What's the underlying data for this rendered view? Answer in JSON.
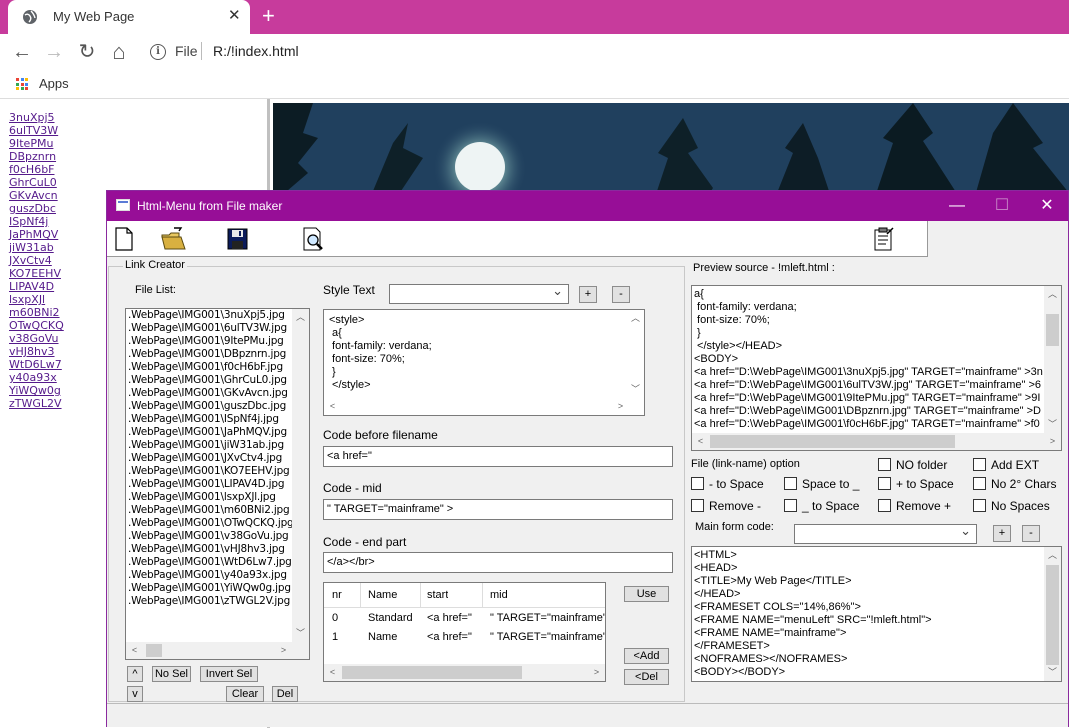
{
  "browser": {
    "tab_title": "My Web Page",
    "tab_close": "✕",
    "new_tab": "+",
    "back": "←",
    "forward": "→",
    "reload": "↻",
    "home": "⌂",
    "info": "i",
    "url_scheme": "File",
    "url": "R:/!index.html",
    "bookmark_apps": "Apps"
  },
  "menu_links": [
    "3nuXpj5",
    "6ulTV3W",
    "9ItePMu",
    "DBpznrn",
    "f0cH6bF",
    "GhrCuL0",
    "GKvAvcn",
    "guszDbc",
    "ISpNf4j",
    "JaPhMQV",
    "jiW31ab",
    "JXvCtv4",
    "KO7EEHV",
    "LIPAV4D",
    "lsxpXJl",
    "m60BNi2",
    "OTwQCKQ",
    "v38GoVu",
    "vHJ8hv3",
    "WtD6Lw7",
    "y40a93x",
    "YiWQw0g",
    "zTWGL2V"
  ],
  "app": {
    "title": "Html-Menu from File maker",
    "minimize": "—",
    "maximize": "☐",
    "close": "✕",
    "toolbar_icons": [
      "new-file-icon",
      "open-folder-icon",
      "save-icon",
      "preview-icon",
      "clipboard-icon"
    ],
    "link_creator": "Link Creator",
    "file_list_label": "File List:",
    "files": [
      ".WebPage\\IMG001\\3nuXpj5.jpg",
      ".WebPage\\IMG001\\6ulTV3W.jpg",
      ".WebPage\\IMG001\\9ItePMu.jpg",
      ".WebPage\\IMG001\\DBpznrn.jpg",
      ".WebPage\\IMG001\\f0cH6bF.jpg",
      ".WebPage\\IMG001\\GhrCuL0.jpg",
      ".WebPage\\IMG001\\GKvAvcn.jpg",
      ".WebPage\\IMG001\\guszDbc.jpg",
      ".WebPage\\IMG001\\ISpNf4j.jpg",
      ".WebPage\\IMG001\\JaPhMQV.jpg",
      ".WebPage\\IMG001\\jiW31ab.jpg",
      ".WebPage\\IMG001\\JXvCtv4.jpg",
      ".WebPage\\IMG001\\KO7EEHV.jpg",
      ".WebPage\\IMG001\\LIPAV4D.jpg",
      ".WebPage\\IMG001\\lsxpXJl.jpg",
      ".WebPage\\IMG001\\m60BNi2.jpg",
      ".WebPage\\IMG001\\OTwQCKQ.jpg",
      ".WebPage\\IMG001\\v38GoVu.jpg",
      ".WebPage\\IMG001\\vHJ8hv3.jpg",
      ".WebPage\\IMG001\\WtD6Lw7.jpg",
      ".WebPage\\IMG001\\y40a93x.jpg",
      ".WebPage\\IMG001\\YiWQw0g.jpg",
      ".WebPage\\IMG001\\zTWGL2V.jpg"
    ],
    "btn_up": "^",
    "btn_down": "v",
    "btn_nosel": "No Sel",
    "btn_invert": "Invert Sel",
    "btn_clear": "Clear",
    "btn_del": "Del",
    "style_text_label": "Style Text",
    "btn_plus": "+",
    "btn_minus": "-",
    "style_text": [
      "<style>",
      " a{",
      " font-family: verdana;",
      " font-size: 70%;",
      " }",
      " </style>"
    ],
    "code_before_label": "Code before filename",
    "code_before": "<a href=\"",
    "code_mid_label": "Code - mid",
    "code_mid": "\" TARGET=\"mainframe\" >",
    "code_end_label": "Code - end part",
    "code_end": "</a></br>",
    "grid_headers": [
      "nr",
      "Name",
      "start",
      "mid"
    ],
    "grid_rows": [
      [
        "0",
        "Standard",
        "<a href=\"",
        "\" TARGET=\"mainframe\""
      ],
      [
        "1",
        "Name",
        "<a href=\"",
        "\" TARGET=\"mainframe\""
      ]
    ],
    "btn_use": "Use",
    "btn_add": "<Add",
    "btn_delrow": "<Del",
    "preview_label": "Preview source - !mleft.html :",
    "preview_lines": [
      "a{",
      " font-family: verdana;",
      " font-size: 70%;",
      " }",
      " </style></HEAD>",
      "<BODY>",
      "<a href=\"D:\\WebPage\\IMG001\\3nuXpj5.jpg\" TARGET=\"mainframe\" >3n",
      "<a href=\"D:\\WebPage\\IMG001\\6ulTV3W.jpg\" TARGET=\"mainframe\" >6",
      "<a href=\"D:\\WebPage\\IMG001\\9ItePMu.jpg\" TARGET=\"mainframe\" >9I",
      "<a href=\"D:\\WebPage\\IMG001\\DBpznrn.jpg\" TARGET=\"mainframe\" >D",
      "<a href=\"D:\\WebPage\\IMG001\\f0cH6bF.jpg\" TARGET=\"mainframe\" >f0"
    ],
    "file_option_label": "File (link-name) option",
    "chk_no_folder": "NO folder",
    "chk_add_ext": "Add EXT",
    "chk_dash_space": "- to Space",
    "chk_space_under": "Space to _",
    "chk_plus_space": "+ to Space",
    "chk_no2chars": "No 2° Chars",
    "chk_remove_dash": "Remove -",
    "chk_under_space": "_ to Space",
    "chk_remove_plus": "Remove +",
    "chk_no_spaces": "No Spaces",
    "main_form_label": "Main form code:",
    "main_code": [
      "<HTML>",
      "<HEAD>",
      "<TITLE>My Web Page</TITLE>",
      "</HEAD>",
      "<FRAMESET COLS=\"14%,86%\">",
      "<FRAME NAME=\"menuLeft\" SRC=\"!mleft.html\">",
      "<FRAME NAME=\"mainframe\">",
      "</FRAMESET>",
      "<NOFRAMES></NOFRAMES>",
      "<BODY></BODY>"
    ]
  },
  "colors": {
    "tab_bar": "#c73b9c",
    "title_bar": "#970e97",
    "link": "#551a8b"
  }
}
